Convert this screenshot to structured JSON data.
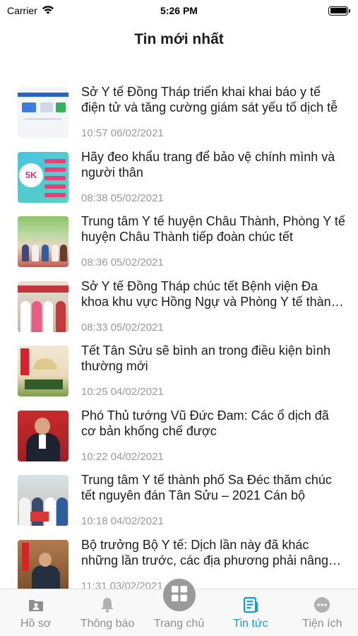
{
  "status_bar": {
    "carrier": "Carrier",
    "time": "5:26 PM"
  },
  "nav": {
    "title": "Tin mới nhất"
  },
  "news": [
    {
      "title": "Sở Y tế Đồng Tháp triển khai khai báo y tế điện tử và tăng cường giám sát yếu tố dịch tễ",
      "time": "10:57 06/02/2021"
    },
    {
      "title": "Hãy đeo khẩu trang để bảo vệ chính mình và người thân",
      "time": "08:38 05/02/2021"
    },
    {
      "title": "Trung tâm Y tế huyện Châu Thành, Phòng Y tế huyện Châu Thành tiếp đoàn chúc tết",
      "time": "08:36 05/02/2021"
    },
    {
      "title": "Sở Y tế Đồng Tháp chúc tết Bệnh viện Đa khoa khu vực Hồng Ngự và Phòng Y tế thành phố",
      "time": "08:33 05/02/2021"
    },
    {
      "title": "Tết Tân Sửu sẽ bình an trong điều kiện bình thường mới",
      "time": "10:25 04/02/2021"
    },
    {
      "title": "Phó Thủ tướng Vũ Đức Đam: Các ổ dịch đã cơ bản khống chế được",
      "time": "10:22 04/02/2021"
    },
    {
      "title": "Trung tâm Y tế thành phố Sa Đéc thăm chúc tết nguyên đán Tân Sửu – 2021 Cán bộ",
      "time": "10:18 04/02/2021"
    },
    {
      "title": "Bộ trưởng Bộ Y tế: Dịch lần này đã khác những lần trước, các địa phương phải nâng cao",
      "time": "11:31 03/02/2021"
    }
  ],
  "thumb_text": {
    "t2": "5K"
  },
  "tabs": [
    {
      "label": "Hồ sơ",
      "icon": "profile-card-icon"
    },
    {
      "label": "Thông báo",
      "icon": "bell-icon"
    },
    {
      "label": "Trang chủ",
      "icon": "grid-icon"
    },
    {
      "label": "Tin tức",
      "icon": "news-icon"
    },
    {
      "label": "Tiện ích",
      "icon": "more-icon"
    }
  ],
  "colors": {
    "active_tab": "#1a9ad6",
    "inactive_tab": "#8e8e93",
    "center_button": "#9a9a9a"
  }
}
